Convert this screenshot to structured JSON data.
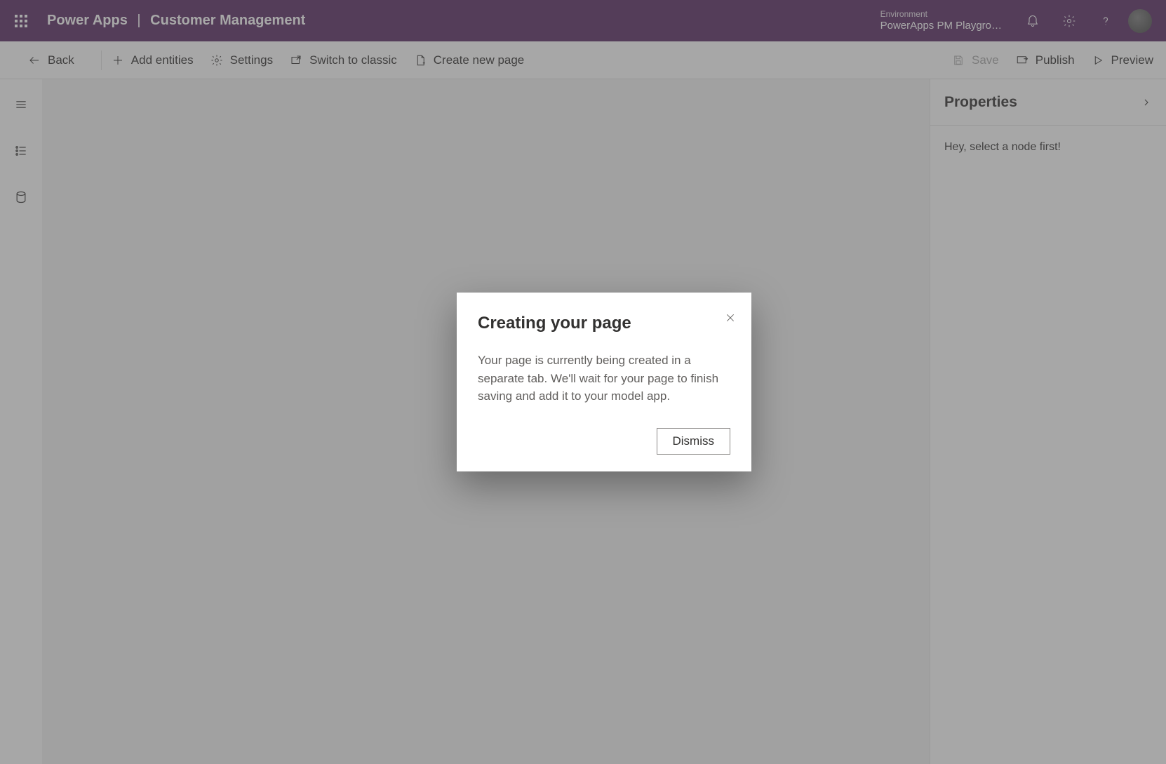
{
  "topbar": {
    "product": "Power Apps",
    "separator": "|",
    "app_name": "Customer Management",
    "environment_label": "Environment",
    "environment_name": "PowerApps PM Playgro…"
  },
  "commands": {
    "back": "Back",
    "add_entities": "Add entities",
    "settings": "Settings",
    "switch_classic": "Switch to classic",
    "create_page": "Create new page",
    "save": "Save",
    "publish": "Publish",
    "preview": "Preview"
  },
  "properties": {
    "title": "Properties",
    "empty_message": "Hey, select a node first!"
  },
  "modal": {
    "title": "Creating your page",
    "body": "Your page is currently being created in a separate tab. We'll wait for your page to finish saving and add it to your model app.",
    "dismiss": "Dismiss"
  }
}
